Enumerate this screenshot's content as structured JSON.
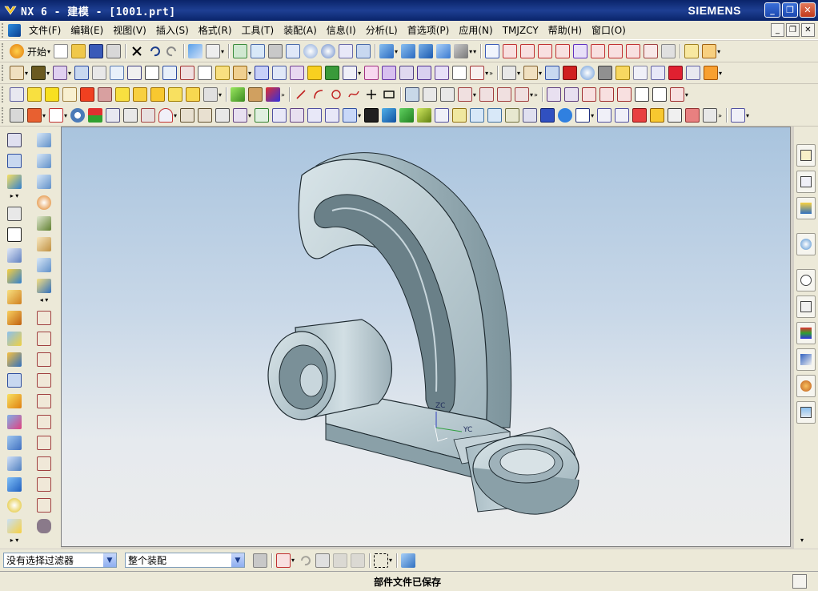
{
  "window": {
    "title": "NX 6 - 建模 - [1001.prt]",
    "brand": "SIEMENS",
    "minimize": "_",
    "maximize": "❐",
    "close": "✕"
  },
  "menubar": {
    "items": [
      "文件(F)",
      "编辑(E)",
      "视图(V)",
      "插入(S)",
      "格式(R)",
      "工具(T)",
      "装配(A)",
      "信息(I)",
      "分析(L)",
      "首选项(P)",
      "应用(N)",
      "TMJZCY",
      "帮助(H)",
      "窗口(O)"
    ]
  },
  "toolbar1": {
    "start_label": "开始"
  },
  "viewport": {
    "axis_z": "ZC",
    "axis_y": "YC",
    "accent_part_color": "#bcd0d8",
    "edge_color": "#1e2a30"
  },
  "filter": {
    "selection_filter": "没有选择过滤器",
    "scope": "整个装配"
  },
  "status": {
    "message": "部件文件已保存"
  },
  "colors": {
    "titlebar": "#0a246a",
    "chrome": "#ece9d8",
    "accent": "#2d8ee0"
  }
}
